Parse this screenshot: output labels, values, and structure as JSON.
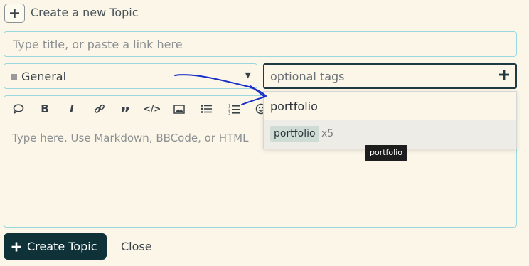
{
  "header": {
    "title": "Create a new Topic",
    "icon": "plus-icon"
  },
  "title_input": {
    "value": "",
    "placeholder": "Type title, or paste a link here"
  },
  "category": {
    "value": "General",
    "swatch_color": "#9a9a9a"
  },
  "tags": {
    "placeholder": "optional tags"
  },
  "editor": {
    "placeholder": "Type here. Use Markdown, BBCode, or HTML",
    "toolbar": [
      "quote-bubble-icon",
      "bold-icon",
      "italic-icon",
      "link-icon",
      "blockquote-icon",
      "code-icon",
      "image-icon",
      "bullet-list-icon",
      "numbered-list-icon",
      "emoji-icon"
    ]
  },
  "tag_dropdown": {
    "query": "portfolio",
    "suggestion": {
      "tag": "portfolio",
      "count": "x5"
    }
  },
  "tooltip": {
    "text": "portfolio"
  },
  "footer": {
    "create_label": "Create Topic",
    "close_label": "Close"
  },
  "colors": {
    "primary": "#0e3238",
    "focus_border": "#9ad8df",
    "background": "#fbf6e8",
    "annotation": "#1a2fc7"
  }
}
